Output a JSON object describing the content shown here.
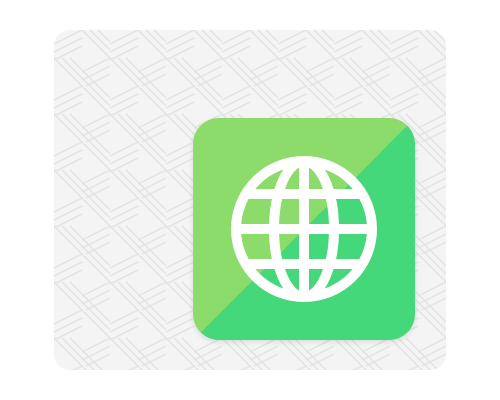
{
  "background": {
    "card_color": "#f4f4f4",
    "pattern_color": "#e2e2e2",
    "pattern": "woven-diagonal-lines"
  },
  "app_icon": {
    "name": "globe-icon",
    "gradient_top_left": "#8bdc6a",
    "gradient_bottom_right": "#45d87a",
    "glyph_color": "#ffffff",
    "glyph": "globe"
  }
}
